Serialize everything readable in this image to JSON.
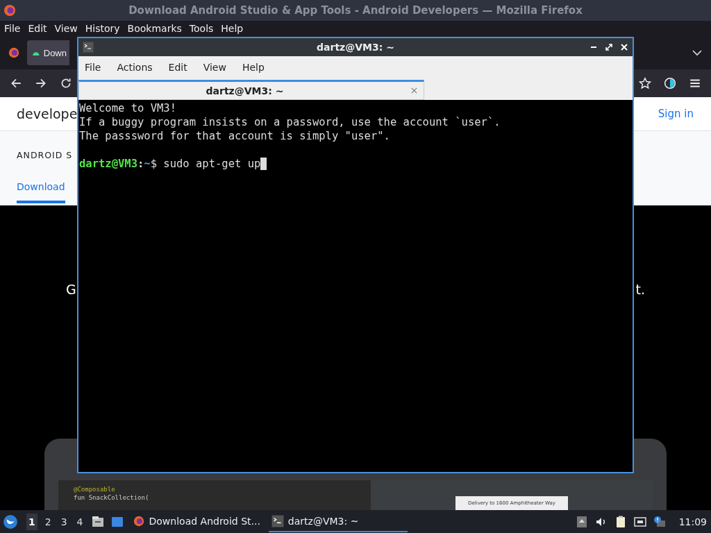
{
  "browser": {
    "title": "Download Android Studio & App Tools - Android Developers — Mozilla Firefox",
    "menu": [
      "File",
      "Edit",
      "View",
      "History",
      "Bookmarks",
      "Tools",
      "Help"
    ],
    "tab": {
      "label": "Down"
    },
    "page": {
      "logo_text": "develope",
      "sign_in": "Sign in",
      "section_title": "ANDROID S",
      "nav_tab": {
        "label": "Download",
        "selected": true
      },
      "hero_left": "G",
      "hero_right": "t.",
      "screenshot": {
        "code_lines": [
          "@Composable",
          "fun SnackCollection("
        ],
        "caption": "Delivery to 1600 Amphitheater Way"
      }
    }
  },
  "terminal": {
    "title": "dartz@VM3: ~",
    "menu": [
      "File",
      "Actions",
      "Edit",
      "View",
      "Help"
    ],
    "tab": {
      "label": "dartz@VM3: ~"
    },
    "lines": [
      "Welcome to VM3!",
      "If a buggy program insists on a password, use the account `user`.",
      "The passsword for that account is simply \"user\"."
    ],
    "prompt": {
      "user_host": "dartz@VM3",
      "separator": ":",
      "path": "~",
      "command": "$ sudo apt-get up"
    }
  },
  "taskbar": {
    "workspaces": [
      {
        "label": "1",
        "selected": true
      },
      {
        "label": "2",
        "selected": false
      },
      {
        "label": "3",
        "selected": false
      },
      {
        "label": "4",
        "selected": false
      }
    ],
    "tasks": [
      {
        "label": "Download Android St...",
        "kind": "firefox",
        "selected": false
      },
      {
        "label": "dartz@VM3: ~",
        "kind": "terminal",
        "selected": true
      }
    ],
    "clock": "11:09"
  }
}
